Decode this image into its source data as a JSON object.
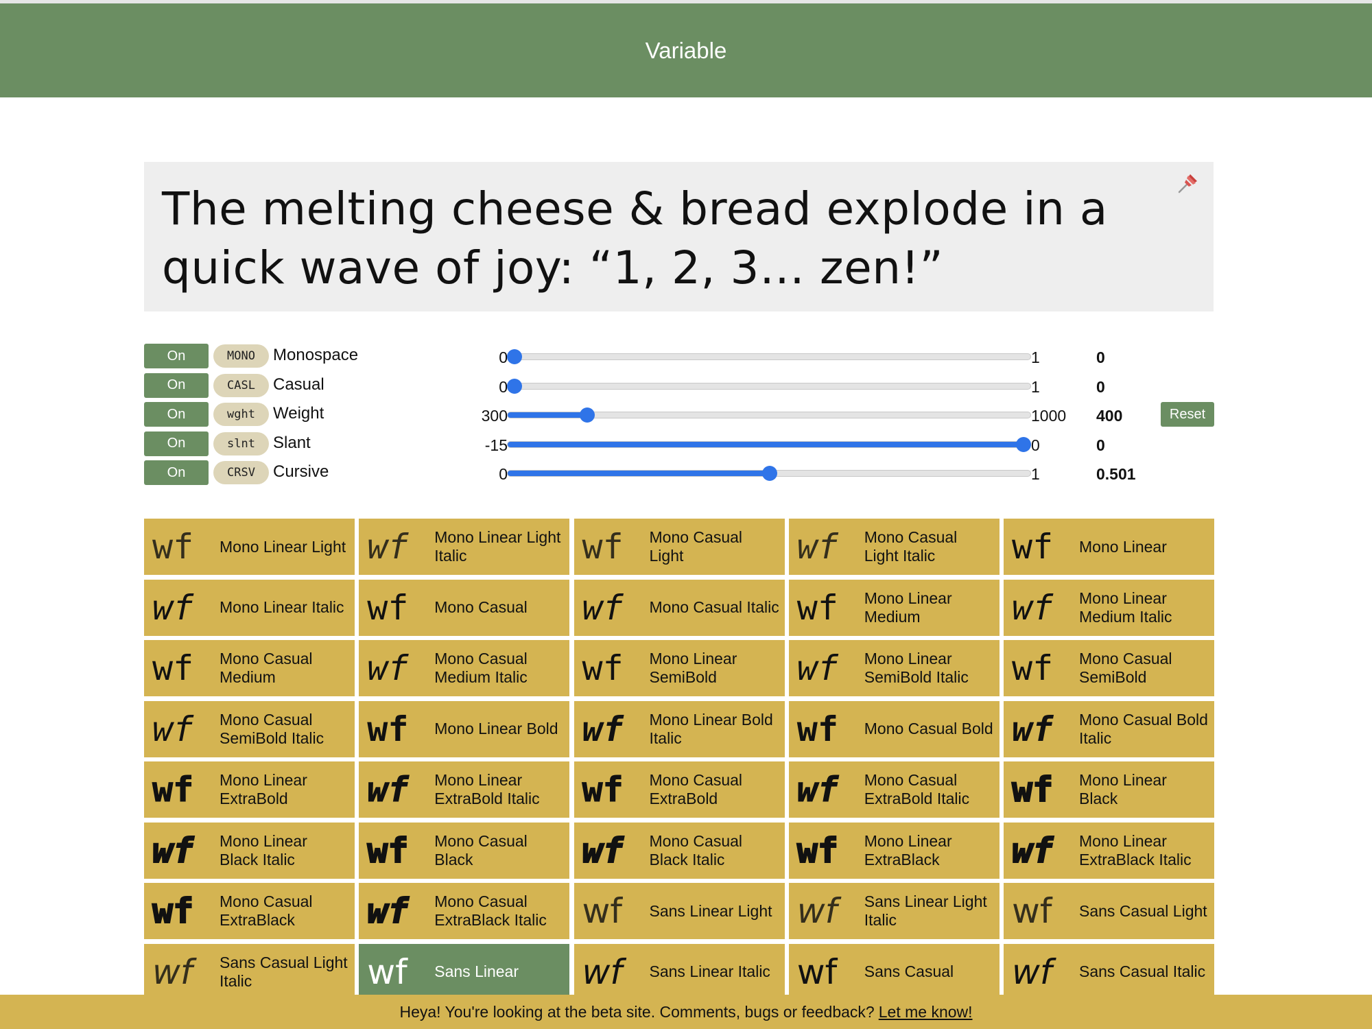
{
  "header": {
    "title": "Variable"
  },
  "preview": {
    "text": "The melting cheese & bread explode in a quick wave of joy: “1, 2, 3… zen!”",
    "pin_icon": "pushpin-icon"
  },
  "axes": [
    {
      "toggle": "On",
      "tag": "MONO",
      "name": "Monospace",
      "min": "0",
      "max": "1",
      "value": "0",
      "fraction": 0.0,
      "fill": false
    },
    {
      "toggle": "On",
      "tag": "CASL",
      "name": "Casual",
      "min": "0",
      "max": "1",
      "value": "0",
      "fraction": 0.0,
      "fill": false
    },
    {
      "toggle": "On",
      "tag": "wght",
      "name": "Weight",
      "min": "300",
      "max": "1000",
      "value": "400",
      "fraction": 0.143,
      "fill": true
    },
    {
      "toggle": "On",
      "tag": "slnt",
      "name": "Slant",
      "min": "-15",
      "max": "0",
      "value": "0",
      "fraction": 1.0,
      "fill": true
    },
    {
      "toggle": "On",
      "tag": "CRSV",
      "name": "Cursive",
      "min": "0",
      "max": "1",
      "value": "0.501",
      "fraction": 0.501,
      "fill": true
    }
  ],
  "reset_label": "Reset",
  "accent_color": "#6b8e62",
  "tile_color": "#d4b452",
  "slider_color": "#2f74e8",
  "tiles": [
    {
      "glyph": "wf",
      "label": "Mono Linear Light",
      "weight": 300,
      "italic": false,
      "mono": true
    },
    {
      "glyph": "wf",
      "label": "Mono Linear Light Italic",
      "weight": 300,
      "italic": true,
      "mono": true
    },
    {
      "glyph": "wf",
      "label": "Mono Casual Light",
      "weight": 300,
      "italic": false,
      "mono": true
    },
    {
      "glyph": "wf",
      "label": "Mono Casual Light Italic",
      "weight": 300,
      "italic": true,
      "mono": true
    },
    {
      "glyph": "wf",
      "label": "Mono Linear",
      "weight": 400,
      "italic": false,
      "mono": true
    },
    {
      "glyph": "wf",
      "label": "Mono Linear Italic",
      "weight": 400,
      "italic": true,
      "mono": true
    },
    {
      "glyph": "wf",
      "label": "Mono Casual",
      "weight": 400,
      "italic": false,
      "mono": true
    },
    {
      "glyph": "wf",
      "label": "Mono Casual Italic",
      "weight": 400,
      "italic": true,
      "mono": true
    },
    {
      "glyph": "wf",
      "label": "Mono Linear Medium",
      "weight": 500,
      "italic": false,
      "mono": true
    },
    {
      "glyph": "wf",
      "label": "Mono Linear Medium Italic",
      "weight": 500,
      "italic": true,
      "mono": true
    },
    {
      "glyph": "wf",
      "label": "Mono Casual Medium",
      "weight": 500,
      "italic": false,
      "mono": true
    },
    {
      "glyph": "wf",
      "label": "Mono Casual Medium Italic",
      "weight": 500,
      "italic": true,
      "mono": true
    },
    {
      "glyph": "wf",
      "label": "Mono Linear SemiBold",
      "weight": 600,
      "italic": false,
      "mono": true
    },
    {
      "glyph": "wf",
      "label": "Mono Linear SemiBold Italic",
      "weight": 600,
      "italic": true,
      "mono": true
    },
    {
      "glyph": "wf",
      "label": "Mono Casual SemiBold",
      "weight": 600,
      "italic": false,
      "mono": true
    },
    {
      "glyph": "wf",
      "label": "Mono Casual SemiBold Italic",
      "weight": 600,
      "italic": true,
      "mono": true
    },
    {
      "glyph": "wf",
      "label": "Mono Linear Bold",
      "weight": 700,
      "italic": false,
      "mono": true
    },
    {
      "glyph": "wf",
      "label": "Mono Linear Bold Italic",
      "weight": 700,
      "italic": true,
      "mono": true
    },
    {
      "glyph": "wf",
      "label": "Mono Casual Bold",
      "weight": 700,
      "italic": false,
      "mono": true
    },
    {
      "glyph": "wf",
      "label": "Mono Casual Bold Italic",
      "weight": 700,
      "italic": true,
      "mono": true
    },
    {
      "glyph": "wf",
      "label": "Mono Linear ExtraBold",
      "weight": 800,
      "italic": false,
      "mono": true
    },
    {
      "glyph": "wf",
      "label": "Mono Linear ExtraBold Italic",
      "weight": 800,
      "italic": true,
      "mono": true
    },
    {
      "glyph": "wf",
      "label": "Mono Casual ExtraBold",
      "weight": 800,
      "italic": false,
      "mono": true
    },
    {
      "glyph": "wf",
      "label": "Mono Casual ExtraBold Italic",
      "weight": 800,
      "italic": true,
      "mono": true
    },
    {
      "glyph": "wf",
      "label": "Mono Linear Black",
      "weight": 900,
      "italic": false,
      "mono": true
    },
    {
      "glyph": "wf",
      "label": "Mono Linear Black Italic",
      "weight": 900,
      "italic": true,
      "mono": true
    },
    {
      "glyph": "wf",
      "label": "Mono Casual Black",
      "weight": 900,
      "italic": false,
      "mono": true
    },
    {
      "glyph": "wf",
      "label": "Mono Casual Black Italic",
      "weight": 900,
      "italic": true,
      "mono": true
    },
    {
      "glyph": "wf",
      "label": "Mono Linear ExtraBlack",
      "weight": 900,
      "italic": false,
      "mono": true
    },
    {
      "glyph": "wf",
      "label": "Mono Linear ExtraBlack Italic",
      "weight": 900,
      "italic": true,
      "mono": true
    },
    {
      "glyph": "wf",
      "label": "Mono Casual ExtraBlack",
      "weight": 900,
      "italic": false,
      "mono": true
    },
    {
      "glyph": "wf",
      "label": "Mono Casual ExtraBlack Italic",
      "weight": 900,
      "italic": true,
      "mono": true
    },
    {
      "glyph": "wf",
      "label": "Sans Linear Light",
      "weight": 300,
      "italic": false,
      "mono": false
    },
    {
      "glyph": "wf",
      "label": "Sans Linear Light Italic",
      "weight": 300,
      "italic": true,
      "mono": false
    },
    {
      "glyph": "wf",
      "label": "Sans Casual Light",
      "weight": 300,
      "italic": false,
      "mono": false
    },
    {
      "glyph": "wf",
      "label": "Sans Casual Light Italic",
      "weight": 300,
      "italic": true,
      "mono": false
    },
    {
      "glyph": "wf",
      "label": "Sans Linear",
      "weight": 400,
      "italic": false,
      "mono": false,
      "selected": true
    },
    {
      "glyph": "wf",
      "label": "Sans Linear Italic",
      "weight": 400,
      "italic": true,
      "mono": false
    },
    {
      "glyph": "wf",
      "label": "Sans Casual",
      "weight": 400,
      "italic": false,
      "mono": false
    },
    {
      "glyph": "wf",
      "label": "Sans Casual Italic",
      "weight": 400,
      "italic": true,
      "mono": false
    }
  ],
  "footer": {
    "message": "Heya! You're looking at the beta site. Comments, bugs or feedback?",
    "link": "Let me know!"
  }
}
